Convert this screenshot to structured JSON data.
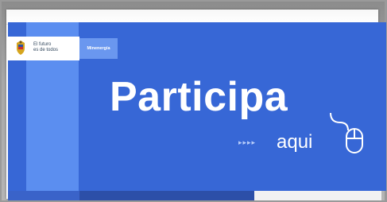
{
  "banner": {
    "logo_line1": "El futuro",
    "logo_line2": "es de todos",
    "ministry": "Minenergía",
    "headline": "Participa",
    "arrows": "▸▸▸▸",
    "subline": "aqui"
  },
  "colors": {
    "banner_blue": "#3767d6",
    "light_blue": "#5b8ef0",
    "white": "#ffffff"
  },
  "icons": {
    "crest": "colombia-coat-of-arms-icon",
    "mouse": "mouse-click-icon"
  }
}
